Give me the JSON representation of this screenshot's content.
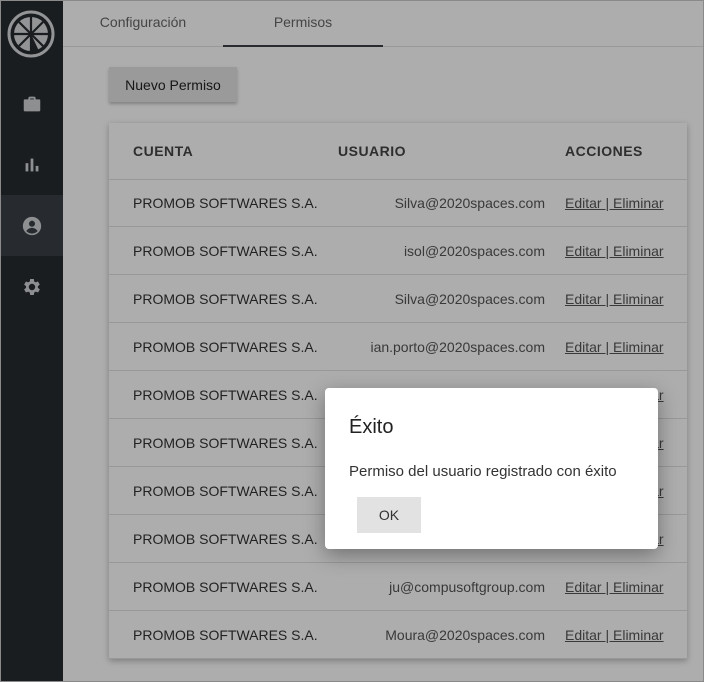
{
  "sidebar": {
    "logo_icon": "citrus-slice-logo",
    "items": [
      {
        "icon": "briefcase-icon",
        "active": false
      },
      {
        "icon": "bar-chart-icon",
        "active": false
      },
      {
        "icon": "account-circle-icon",
        "active": true
      },
      {
        "icon": "gear-icon",
        "active": false
      }
    ]
  },
  "tabs": [
    {
      "label": "Configuración",
      "active": false
    },
    {
      "label": "Permisos",
      "active": true
    }
  ],
  "toolbar": {
    "new_permission_label": "Nuevo Permiso"
  },
  "table": {
    "headers": {
      "account": "CUENTA",
      "user": "USUARIO",
      "actions": "ACCIONES"
    },
    "edit_label": "Editar",
    "separator": " | ",
    "delete_label": "Eliminar",
    "rows": [
      {
        "account": "PROMOB SOFTWARES S.A.",
        "user": "Silva@2020spaces.com"
      },
      {
        "account": "PROMOB SOFTWARES S.A.",
        "user": "isol@2020spaces.com"
      },
      {
        "account": "PROMOB SOFTWARES S.A.",
        "user": "Silva@2020spaces.com"
      },
      {
        "account": "PROMOB SOFTWARES S.A.",
        "user": "ian.porto@2020spaces.com"
      },
      {
        "account": "PROMOB SOFTWARES S.A.",
        "user": ""
      },
      {
        "account": "PROMOB SOFTWARES S.A.",
        "user": ""
      },
      {
        "account": "PROMOB SOFTWARES S.A.",
        "user": ""
      },
      {
        "account": "PROMOB SOFTWARES S.A.",
        "user": ""
      },
      {
        "account": "PROMOB SOFTWARES S.A.",
        "user": "ju@compusoftgroup.com"
      },
      {
        "account": "PROMOB SOFTWARES S.A.",
        "user": "Moura@2020spaces.com"
      }
    ]
  },
  "dialog": {
    "title": "Éxito",
    "message": "Permiso del usuario registrado con éxito",
    "ok_label": "OK"
  },
  "colors": {
    "sidebar_bg": "#272b30",
    "sidebar_active": "#3a4048",
    "icon": "#d0d3d6"
  }
}
